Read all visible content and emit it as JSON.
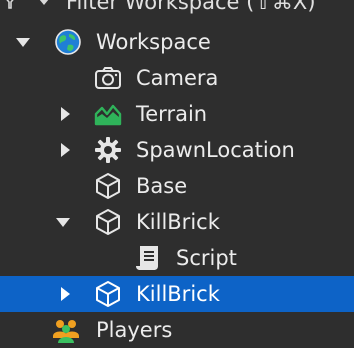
{
  "filter": {
    "text": "Filter Workspace (⇧⌘X)"
  },
  "tree": {
    "workspace": {
      "label": "Workspace",
      "icon": "globe-icon",
      "expanded": true
    },
    "camera": {
      "label": "Camera",
      "icon": "camera-icon"
    },
    "terrain": {
      "label": "Terrain",
      "icon": "terrain-icon",
      "expanded": false
    },
    "spawn": {
      "label": "SpawnLocation",
      "icon": "gear-icon",
      "expanded": false
    },
    "base": {
      "label": "Base",
      "icon": "part-cube-icon"
    },
    "killbrick1": {
      "label": "KillBrick",
      "icon": "part-cube-icon",
      "expanded": true
    },
    "script": {
      "label": "Script",
      "icon": "script-icon"
    },
    "killbrick2": {
      "label": "KillBrick",
      "icon": "part-cube-icon",
      "expanded": false,
      "selected": true
    },
    "players": {
      "label": "Players",
      "icon": "players-icon"
    }
  },
  "colors": {
    "background": "#2e2e2e",
    "selection": "#0d63c7",
    "text": "#ececec",
    "terrain_green": "#2fb35a",
    "players_orange": "#f0a020",
    "players_green": "#3ac060"
  }
}
